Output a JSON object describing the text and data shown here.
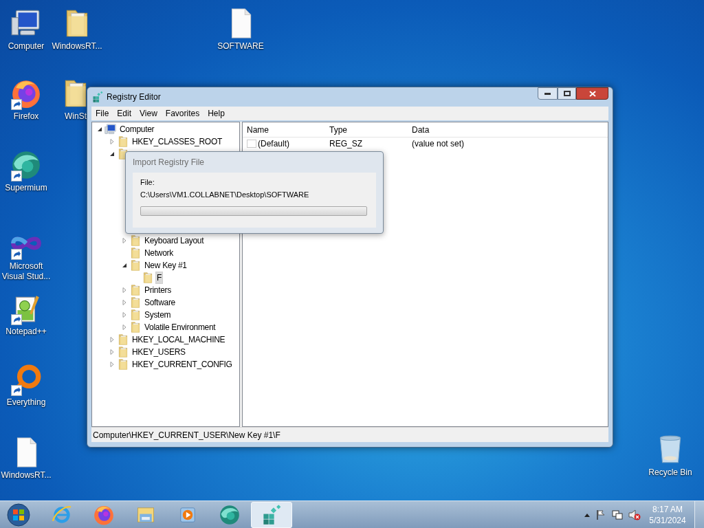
{
  "desktop_icons": [
    {
      "label": "Computer",
      "kind": "computer",
      "shortcut": false
    },
    {
      "label": "WindowsRT...",
      "kind": "folder",
      "shortcut": false
    },
    {
      "label": "SOFTWARE",
      "kind": "file",
      "shortcut": false
    },
    {
      "label": "Firefox",
      "kind": "firefox",
      "shortcut": true
    },
    {
      "label": "WinSt",
      "kind": "folder",
      "shortcut": false
    },
    {
      "label": "Supermium",
      "kind": "supermium",
      "shortcut": true
    },
    {
      "label": "Microsoft Visual Stud...",
      "kind": "visualstudio",
      "shortcut": true
    },
    {
      "label": "Notepad++",
      "kind": "notepad",
      "shortcut": true
    },
    {
      "label": "Everything",
      "kind": "everything",
      "shortcut": true
    },
    {
      "label": "WindowsRT...",
      "kind": "file",
      "shortcut": false
    },
    {
      "label": "Recycle Bin",
      "kind": "recycle",
      "shortcut": false
    }
  ],
  "window": {
    "title": "Registry Editor",
    "menu": [
      "File",
      "Edit",
      "View",
      "Favorites",
      "Help"
    ],
    "tree": {
      "label": "Computer",
      "kind": "computer",
      "expanded": true,
      "selected": false,
      "children": [
        {
          "label": "HKEY_CLASSES_ROOT",
          "kind": "folder",
          "expanded": false,
          "selected": false
        },
        {
          "kind": "folder",
          "expanded": true,
          "selected": false,
          "children": [
            {
              "label": "Keyboard Layout",
              "kind": "folder",
              "expanded": false,
              "selected": false
            },
            {
              "label": "Network",
              "kind": "folder",
              "selected": false
            },
            {
              "label": "New Key #1",
              "kind": "folder",
              "expanded": true,
              "selected": false,
              "children": [
                {
                  "label": "F",
                  "kind": "folder",
                  "selected": true
                }
              ]
            },
            {
              "label": "Printers",
              "kind": "folder",
              "expanded": false,
              "selected": false
            },
            {
              "label": "Software",
              "kind": "folder",
              "expanded": false,
              "selected": false
            },
            {
              "label": "System",
              "kind": "folder",
              "expanded": false,
              "selected": false
            },
            {
              "label": "Volatile Environment",
              "kind": "folder",
              "expanded": false,
              "selected": false
            }
          ]
        },
        {
          "label": "HKEY_LOCAL_MACHINE",
          "kind": "folder",
          "expanded": false,
          "selected": false
        },
        {
          "label": "HKEY_USERS",
          "kind": "folder",
          "expanded": false,
          "selected": false
        },
        {
          "label": "HKEY_CURRENT_CONFIG",
          "kind": "folder",
          "expanded": false,
          "selected": false
        }
      ]
    },
    "list": {
      "columns": [
        "Name",
        "Type",
        "Data"
      ],
      "rows": [
        {
          "name": "(Default)",
          "type": "REG_SZ",
          "data": "(value not set)"
        }
      ]
    },
    "status_bar": "Computer\\HKEY_CURRENT_USER\\New Key #1\\F"
  },
  "dialog": {
    "title": "Import Registry File",
    "file_label": "File:",
    "path": "C:\\Users\\VM1.COLLABNET\\Desktop\\SOFTWARE",
    "progress": {
      "level": 0
    }
  },
  "taskbar": {
    "apps": [
      {
        "kind": "ie",
        "selected": false
      },
      {
        "kind": "firefox",
        "selected": false
      },
      {
        "kind": "explorer",
        "selected": false
      },
      {
        "kind": "mediaplayer",
        "selected": false
      },
      {
        "kind": "supermium",
        "selected": false
      },
      {
        "kind": "regedit",
        "selected": true
      }
    ],
    "clock": {
      "time": "8:17 AM",
      "date": "5/31/2024"
    }
  }
}
